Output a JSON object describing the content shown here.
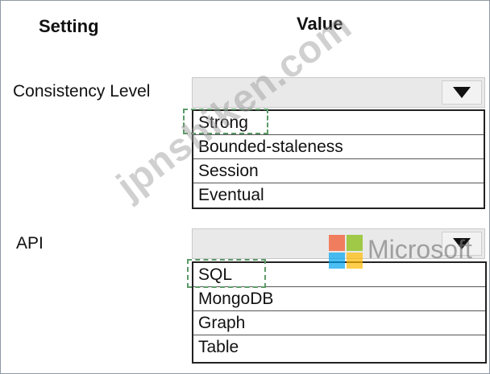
{
  "headers": {
    "setting": "Setting",
    "value": "Value"
  },
  "rows": [
    {
      "label": "Consistency Level",
      "options": [
        "Strong",
        "Bounded-staleness",
        "Session",
        "Eventual"
      ],
      "highlighted": "Strong"
    },
    {
      "label": "API",
      "options": [
        "SQL",
        "MongoDB",
        "Graph",
        "Table"
      ],
      "highlighted": "SQL"
    }
  ],
  "watermark": "jpnshiken.com",
  "brand": {
    "text": "Microsoft",
    "colors": [
      "#f25022",
      "#7fba00",
      "#00a4ef",
      "#ffb900"
    ]
  },
  "icons": {
    "dropdown": "chevron-down-icon"
  }
}
